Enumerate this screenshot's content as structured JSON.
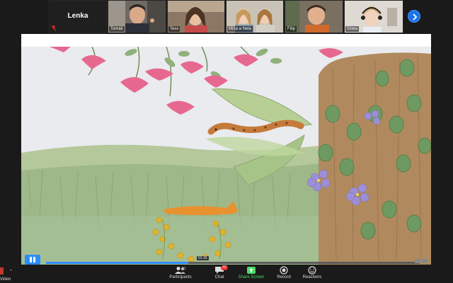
{
  "participants": [
    {
      "name": "Lenka",
      "video": false
    },
    {
      "name": "Tomáš",
      "video": true
    },
    {
      "name": "Tess",
      "video": true
    },
    {
      "name": "Míša a Nela",
      "video": true
    },
    {
      "name": "Filip",
      "video": true
    },
    {
      "name": "Greta",
      "video": true
    }
  ],
  "share": {
    "timestamp": "01:15",
    "progress": 0.38
  },
  "toolbar": {
    "video_label": "Video",
    "participants_label": "Participants",
    "participants_count": "21",
    "chat_label": "Chat",
    "chat_badge": "33",
    "share_label": "Share Screen",
    "record_label": "Record",
    "reactions_label": "Reactions"
  },
  "colors": {
    "accent": "#2d8cff",
    "share_green": "#4cd964",
    "badge_red": "#e02828"
  },
  "icons": [
    "mic-muted-icon",
    "chevron-right-icon",
    "pause-icon",
    "participants-icon",
    "chat-icon",
    "share-screen-icon",
    "record-icon",
    "reactions-icon"
  ]
}
